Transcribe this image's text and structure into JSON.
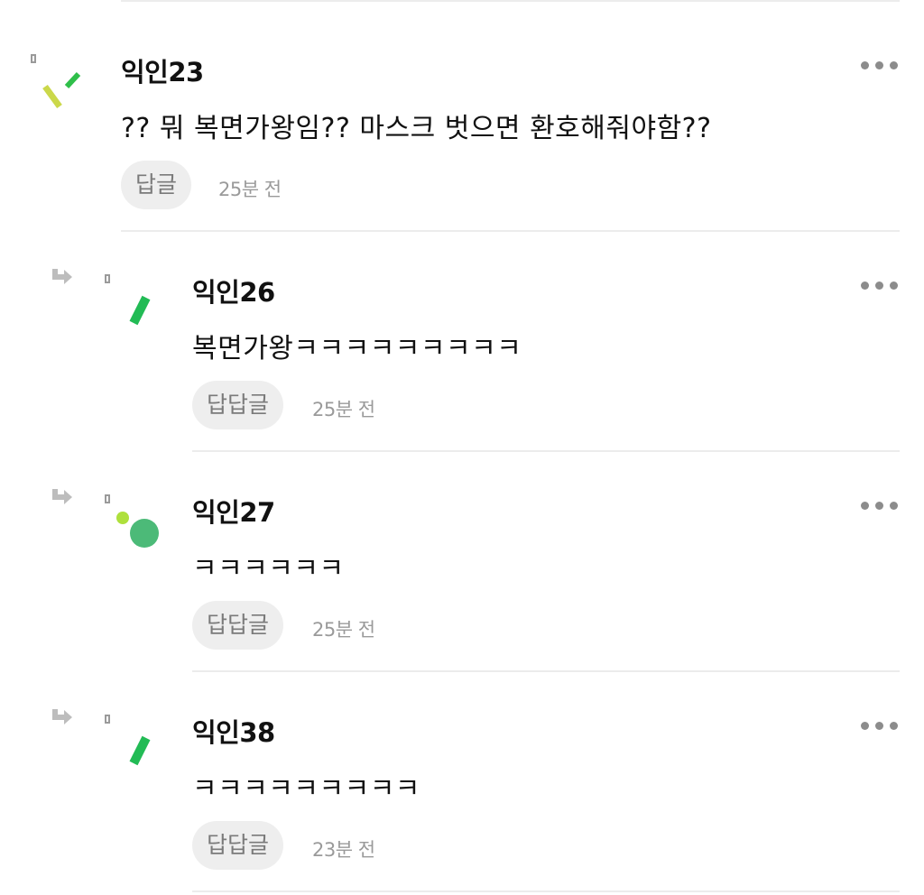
{
  "comments": [
    {
      "author": "익인23",
      "text": "?? 뭐 복면가왕임?? 마스크 벗으면 환호해줘야함??",
      "reply_label": "답글",
      "time": "25분 전",
      "avatar_icon": "yellow-green-dashes-avatar-icon"
    },
    {
      "author": "익인26",
      "text": "복면가왕ㅋㅋㅋㅋㅋㅋㅋㅋㅋ",
      "reply_label": "답답글",
      "time": "25분 전",
      "avatar_icon": "green-slash-avatar-icon"
    },
    {
      "author": "익인27",
      "text": "ㅋㅋㅋㅋㅋㅋ",
      "reply_label": "답답글",
      "time": "25분 전",
      "avatar_icon": "green-circle-avatar-icon"
    },
    {
      "author": "익인38",
      "text": "ㅋㅋㅋㅋㅋㅋㅋㅋㅋ",
      "reply_label": "답답글",
      "time": "23분 전",
      "avatar_icon": "green-slash-avatar-icon"
    }
  ],
  "colors": {
    "divider": "#ececec",
    "button_bg": "#eeeeee",
    "muted_text": "#9a9a9a",
    "avatar_green": "#22bb55",
    "avatar_lime": "#aee03c",
    "avatar_yellow": "#cbd84a"
  }
}
